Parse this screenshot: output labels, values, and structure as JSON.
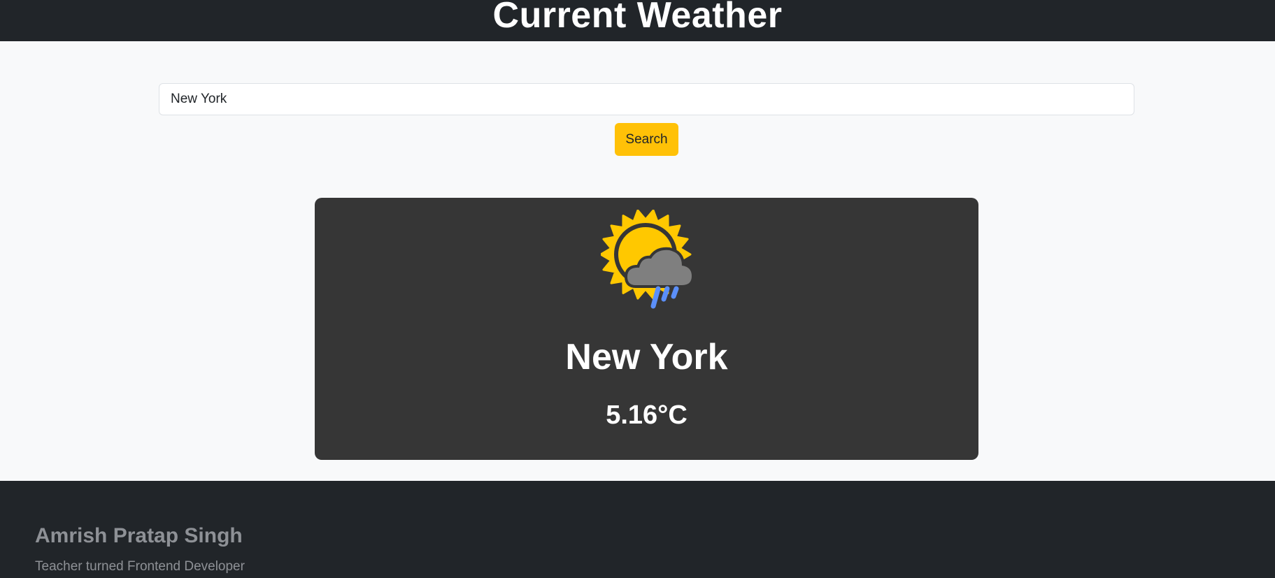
{
  "header": {
    "title": "Current Weather"
  },
  "search": {
    "value": "New York",
    "button_label": "Search"
  },
  "weather": {
    "icon": "sun-with-rain-cloud-icon",
    "city": "New York",
    "temperature": "5.16°C"
  },
  "footer": {
    "name": "Amrish Pratap Singh",
    "tagline": "Teacher turned Frontend Developer"
  },
  "colors": {
    "header_bg": "#212529",
    "page_bg": "#f8f9fa",
    "card_bg": "#363636",
    "button_bg": "#ffc107",
    "sun": "#ffc800",
    "cloud": "#7f7f7f",
    "rain": "#5b8ff9",
    "footer_text": "#8e9196"
  }
}
